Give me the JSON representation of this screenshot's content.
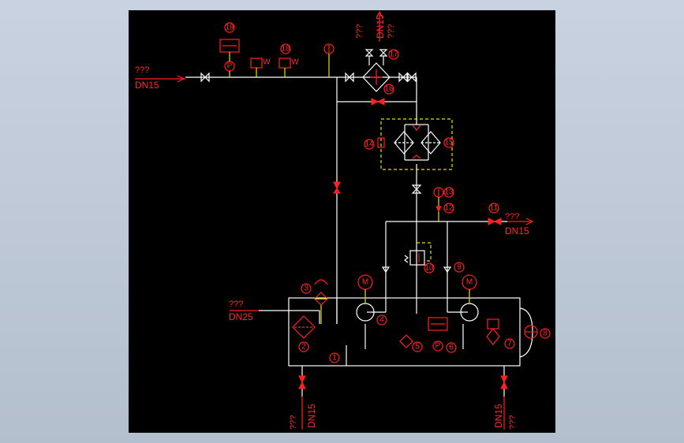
{
  "ports": {
    "top_left": {
      "q": "???",
      "dn": "DN15"
    },
    "top_center": {
      "q": "???",
      "dn": "DN15",
      "q2": "???"
    },
    "right": {
      "q": "???",
      "dn": "DN15"
    },
    "left": {
      "q": "???",
      "dn": "DN25"
    },
    "bottom_left": {
      "q": "???",
      "dn": "DN15"
    },
    "bottom_right": {
      "q": "???",
      "dn": "DN15",
      "q2": "???"
    }
  },
  "tags": [
    "1",
    "2",
    "3",
    "4",
    "5",
    "6",
    "7",
    "8",
    "9",
    "10",
    "11",
    "12",
    "13",
    "14",
    "15",
    "16",
    "17",
    "18",
    "19"
  ],
  "symbols": {
    "motor": "M",
    "pressure": "P",
    "weight": "W"
  }
}
